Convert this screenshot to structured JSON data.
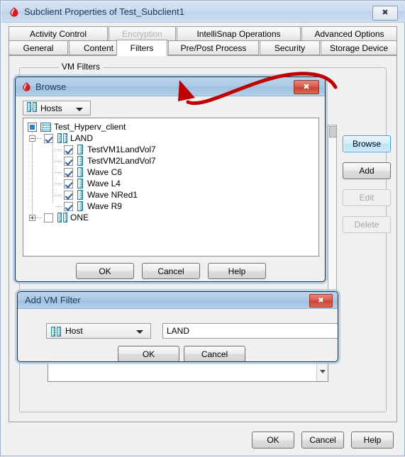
{
  "window": {
    "title": "Subclient Properties of Test_Subclient1",
    "icon": "commvault-drop-icon",
    "close_label": "✖"
  },
  "tabs": {
    "row1": [
      {
        "label": "Activity Control",
        "state": "normal"
      },
      {
        "label": "Encryption",
        "state": "disabled"
      },
      {
        "label": "IntelliSnap Operations",
        "state": "normal"
      },
      {
        "label": "Advanced Options",
        "state": "normal"
      }
    ],
    "row2": [
      {
        "label": "General",
        "state": "normal"
      },
      {
        "label": "Content",
        "state": "normal"
      },
      {
        "label": "Filters",
        "state": "active"
      },
      {
        "label": "Pre/Post Process",
        "state": "normal"
      },
      {
        "label": "Security",
        "state": "normal"
      },
      {
        "label": "Storage Device",
        "state": "normal"
      }
    ]
  },
  "filters_panel": {
    "group_label": "VM Filters",
    "buttons": [
      {
        "label": "Browse",
        "state": "focused"
      },
      {
        "label": "Add",
        "state": "normal"
      },
      {
        "label": "Edit",
        "state": "disabled"
      },
      {
        "label": "Delete",
        "state": "disabled"
      }
    ]
  },
  "browse_dialog": {
    "title": "Browse",
    "icon": "commvault-drop-icon",
    "close_label": "✖",
    "combo": {
      "value": "Hosts",
      "icon": "host-server-icon"
    },
    "tree": [
      {
        "label": "Test_Hyperv_client",
        "level": 0,
        "icon": "client-grid-icon",
        "box": "selected",
        "expander": "none"
      },
      {
        "label": "LAND",
        "level": 1,
        "icon": "host-server-icon",
        "box": "checked",
        "expander": "minus"
      },
      {
        "label": "TestVM1LandVol7",
        "level": 2,
        "icon": "vm-icon",
        "box": "checked",
        "expander": "none"
      },
      {
        "label": "TestVM2LandVol7",
        "level": 2,
        "icon": "vm-icon",
        "box": "checked",
        "expander": "none"
      },
      {
        "label": "Wave C6",
        "level": 2,
        "icon": "vm-icon",
        "box": "checked",
        "expander": "none"
      },
      {
        "label": "Wave L4",
        "level": 2,
        "icon": "vm-icon",
        "box": "checked",
        "expander": "none"
      },
      {
        "label": "Wave NRed1",
        "level": 2,
        "icon": "vm-icon",
        "box": "checked",
        "expander": "none"
      },
      {
        "label": "Wave R9",
        "level": 2,
        "icon": "vm-icon",
        "box": "checked",
        "expander": "none"
      },
      {
        "label": "ONE",
        "level": 1,
        "icon": "host-server-icon",
        "box": "unchecked",
        "expander": "plus"
      }
    ],
    "buttons": [
      {
        "label": "OK"
      },
      {
        "label": "Cancel"
      },
      {
        "label": "Help"
      }
    ]
  },
  "add_vm_filter_dialog": {
    "title": "Add VM Filter",
    "close_label": "✖",
    "type_combo": {
      "value": "Host",
      "icon": "host-server-icon"
    },
    "name_input": {
      "value": "LAND",
      "placeholder": ""
    },
    "buttons": [
      {
        "label": "OK"
      },
      {
        "label": "Cancel"
      }
    ]
  },
  "bottom_buttons": [
    {
      "label": "OK"
    },
    {
      "label": "Cancel"
    },
    {
      "label": "Help"
    }
  ],
  "annotation": {
    "type": "red-curved-arrow",
    "color": "#c00000",
    "from": "browse-button",
    "to": "browse-dialog-titlebar"
  }
}
